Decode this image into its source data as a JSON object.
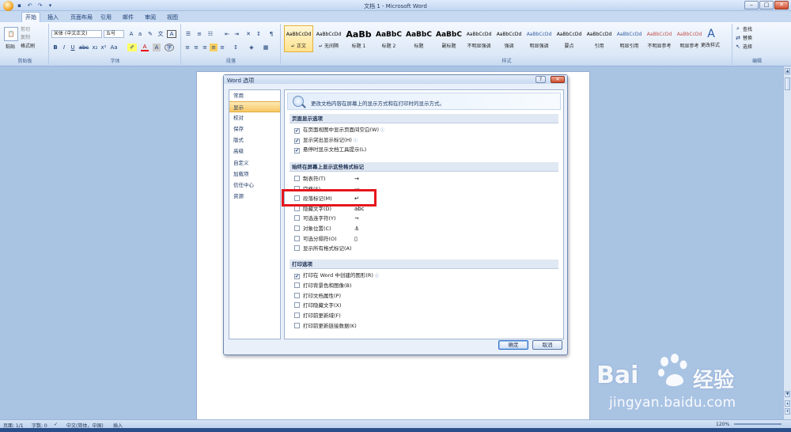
{
  "window": {
    "title": "文档 1 - Microsoft Word"
  },
  "tabs": [
    "开始",
    "插入",
    "页面布局",
    "引用",
    "邮件",
    "审阅",
    "视图"
  ],
  "ribbon": {
    "clipboard": {
      "paste": "粘贴",
      "cut": "剪切",
      "copy": "复制",
      "format_painter": "格式刷",
      "label": "剪贴板"
    },
    "font": {
      "font_name": "宋体 (中文正文)",
      "font_size": "五号",
      "label": "字体"
    },
    "paragraph": {
      "label": "段落"
    },
    "styles": {
      "label": "样式",
      "items": [
        {
          "preview": "AaBbCcDd",
          "name": "↵ 正文"
        },
        {
          "preview": "AaBbCcDd",
          "name": "↵ 无间隔"
        },
        {
          "preview": "AaBb",
          "name": "标题 1"
        },
        {
          "preview": "AaBbC",
          "name": "标题 2"
        },
        {
          "preview": "AaBbC",
          "name": "标题"
        },
        {
          "preview": "AaBbC",
          "name": "副标题"
        },
        {
          "preview": "AaBbCcDd",
          "name": "不明显强调"
        },
        {
          "preview": "AaBbCcDd",
          "name": "强调"
        },
        {
          "preview": "AaBbCcDd",
          "name": "明显强调"
        },
        {
          "preview": "AaBbCcDd",
          "name": "要点"
        },
        {
          "preview": "AaBbCcDd",
          "name": "引用"
        },
        {
          "preview": "AaBbCcDd",
          "name": "明显引用"
        },
        {
          "preview": "AaBbCcDd",
          "name": "不明显参考"
        },
        {
          "preview": "AaBbCcDd",
          "name": "明显参考"
        }
      ],
      "change_styles": "更改样式"
    },
    "editing": {
      "find": "查找",
      "replace": "替换",
      "select": "选择",
      "label": "编辑"
    }
  },
  "dialog": {
    "title": "Word 选项",
    "nav": [
      "常用",
      "显示",
      "校对",
      "保存",
      "版式",
      "高级",
      "自定义",
      "加载项",
      "信任中心",
      "资源"
    ],
    "banner": "更改文档内容在屏幕上的显示方式和在打印时的显示方式。",
    "sections": {
      "page_display": "页面显示选项",
      "formatting_marks": "始终在屏幕上显示这些格式标记",
      "printing": "打印选项"
    },
    "page_options": [
      {
        "label": "在页面视图中显示页面间空白(W)",
        "checked": true,
        "info": true
      },
      {
        "label": "显示突出显示标记(H)",
        "checked": true,
        "info": true
      },
      {
        "label": "悬停时显示文档工具提示(L)",
        "checked": true,
        "info": false
      }
    ],
    "format_marks": [
      {
        "label": "制表符(T)",
        "symbol": "→",
        "checked": false
      },
      {
        "label": "空格(S)",
        "symbol": "···",
        "checked": false
      },
      {
        "label": "段落标记(M)",
        "symbol": "↵",
        "checked": false
      },
      {
        "label": "隐藏文字(D)",
        "symbol": "abc",
        "checked": false
      },
      {
        "label": "可选连字符(Y)",
        "symbol": "¬",
        "checked": false
      },
      {
        "label": "对象位置(C)",
        "symbol": "⚓",
        "checked": false
      },
      {
        "label": "可选分隔符(O)",
        "symbol": "▯",
        "checked": false
      },
      {
        "label": "显示所有格式标记(A)",
        "symbol": "",
        "checked": false
      }
    ],
    "print_options": [
      {
        "label": "打印在 Word 中创建的图形(R)",
        "checked": true,
        "info": true
      },
      {
        "label": "打印背景色和图像(B)",
        "checked": false,
        "info": false
      },
      {
        "label": "打印文档属性(P)",
        "checked": false,
        "info": false
      },
      {
        "label": "打印隐藏文字(X)",
        "checked": false,
        "info": false
      },
      {
        "label": "打印前更新域(F)",
        "checked": false,
        "info": false
      },
      {
        "label": "打印前更新链接数据(K)",
        "checked": false,
        "info": false
      }
    ],
    "ok": "确定",
    "cancel": "取消"
  },
  "status": {
    "page": "页面: 1/1",
    "words": "字数: 0",
    "language": "中文(简体，中国)",
    "mode": "插入",
    "zoom": "120%"
  },
  "watermark": {
    "brand_left": "Bai",
    "brand_right": "经验",
    "url": "jingyan.baidu.com"
  }
}
